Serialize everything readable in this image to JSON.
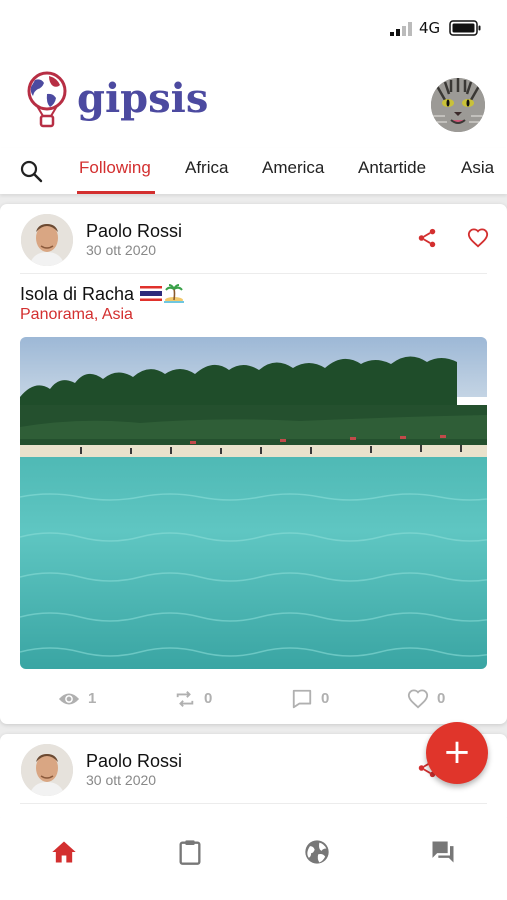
{
  "status_bar": {
    "network": "4G"
  },
  "app": {
    "logo_text": "gipsis"
  },
  "tabs": [
    {
      "label": "Following"
    },
    {
      "label": "Africa"
    },
    {
      "label": "America"
    },
    {
      "label": "Antartide"
    },
    {
      "label": "Asia"
    }
  ],
  "posts": [
    {
      "author": "Paolo Rossi",
      "date": "30 ott 2020",
      "title": "Isola di Racha",
      "subtitle": "Panorama, Asia",
      "stats": {
        "views": "1",
        "reposts": "0",
        "comments": "0",
        "likes": "0"
      }
    },
    {
      "author": "Paolo Rossi",
      "date": "30 ott 2020"
    }
  ],
  "fab": {
    "label": "+"
  },
  "colors": {
    "accent": "#d32f2f",
    "logo": "#4c4aa0",
    "fab": "#e0352b"
  },
  "icons": {
    "search": "search-icon",
    "share": "share-icon",
    "heart": "heart-icon",
    "views": "eye-icon",
    "reposts": "repeat-icon",
    "comments": "comment-icon",
    "nav": [
      "home-icon",
      "clipboard-icon",
      "globe-icon",
      "chat-icon"
    ]
  }
}
